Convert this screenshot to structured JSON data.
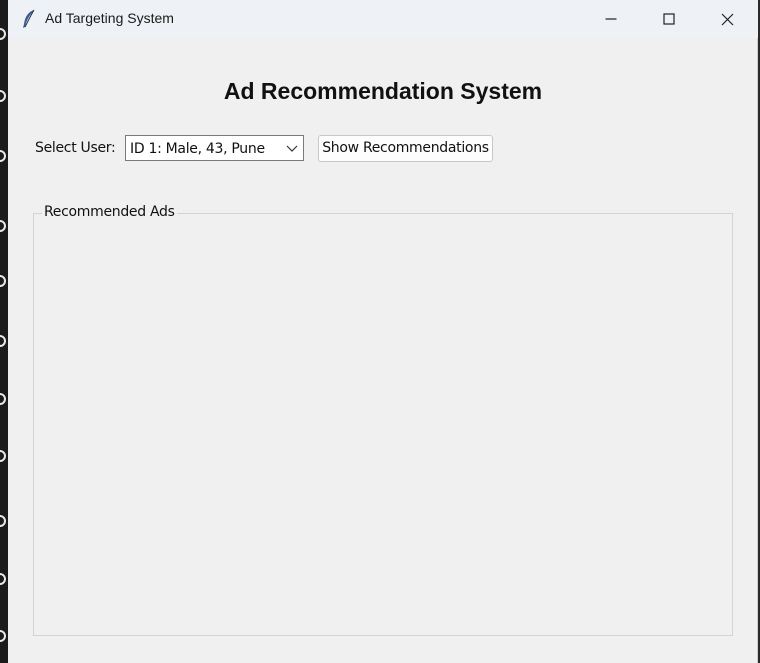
{
  "window": {
    "title": "Ad Targeting System",
    "icon": "feather-icon",
    "controls": {
      "minimize": "minimize-icon",
      "maximize": "maximize-icon",
      "close": "close-icon"
    }
  },
  "main": {
    "heading": "Ad Recommendation System",
    "select_user_label": "Select User:",
    "user_select": {
      "value": "ID 1: Male, 43, Pune"
    },
    "show_button_label": "Show Recommendations",
    "recommended_group": {
      "label": "Recommended Ads",
      "items": []
    }
  },
  "colors": {
    "window_bg": "#f0f0f0",
    "titlebar_bg": "#eef2f7",
    "text": "#111111"
  }
}
